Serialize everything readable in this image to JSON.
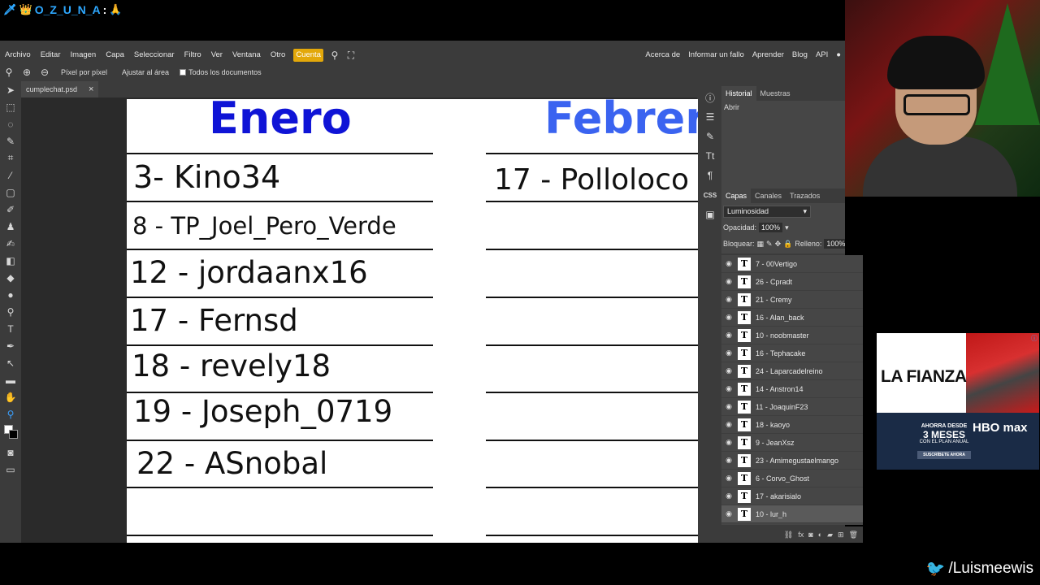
{
  "chat": {
    "user": "O_Z_U_N_A",
    "colon": ":"
  },
  "menu": {
    "items": [
      "Archivo",
      "Editar",
      "Imagen",
      "Capa",
      "Seleccionar",
      "Filtro",
      "Ver",
      "Ventana",
      "Otro"
    ],
    "active": "Cuenta",
    "right": [
      "Acerca de",
      "Informar un fallo",
      "Aprender",
      "Blog",
      "API"
    ]
  },
  "options": {
    "pixel": "Píxel por píxel",
    "fit": "Ajustar al área",
    "all_docs": "Todos los documentos"
  },
  "tab": {
    "name": "cumplechat.psd",
    "close": "×"
  },
  "canvas": {
    "month1": "Enero",
    "month2": "Febrer",
    "enero": [
      "3- Kino34",
      "8 - TP_Joel_Pero_Verde",
      "12 - jordaanx16",
      "17 - Fernsd",
      "18 - revely18",
      "19 - Joseph_0719",
      "22 - ASnobal"
    ],
    "febrero": [
      "17 - Polloloco"
    ]
  },
  "history": {
    "tabs": [
      "Historial",
      "Muestras"
    ],
    "item": "Abrir"
  },
  "layers_panel": {
    "tabs": [
      "Capas",
      "Canales",
      "Trazados"
    ],
    "blend": "Luminosidad",
    "opacity_label": "Opacidad:",
    "opacity": "100%",
    "lock_label": "Bloquear:",
    "fill_label": "Relleno:",
    "fill": "100%",
    "layers": [
      "7 - 00Vertigo",
      "26 - Cpradt",
      "21 - Cremy",
      "16 - Alan_back",
      "10 - noobmaster",
      "16 - Tephacake",
      "24 - Laparcadelreino",
      "14 - Anstron14",
      "11 - JoaquinF23",
      "18 - kaoyo",
      "9 - JeanXsz",
      "23 - Amimegustaelmango",
      "6 - Corvo_Ghost",
      "17 - akarisialo",
      "10 - lur_h"
    ]
  },
  "ad": {
    "title": "LA FIANZA",
    "line1": "AHORRA DESDE",
    "line2": "3 MESES",
    "line3": "CON EL PLAN ANUAL",
    "logo": "HBO max",
    "cta": "SUSCRÍBETE AHORA"
  },
  "handle": "/Luismeewis",
  "colors": {
    "accent": "#e3a80a",
    "enero": "#0f14d6",
    "febrero": "#3a63f0",
    "chat_user": "#2ea8ff"
  }
}
